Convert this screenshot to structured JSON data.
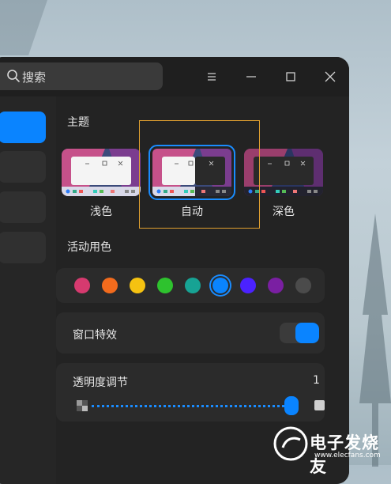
{
  "search": {
    "label": "搜索"
  },
  "titlebar": {
    "menu_icon": "menu-icon",
    "minimize_icon": "minimize-icon",
    "maximize_icon": "maximize-icon",
    "close_icon": "close-icon"
  },
  "theme": {
    "title": "主题",
    "options": [
      {
        "label": "浅色",
        "selected": false
      },
      {
        "label": "自动",
        "selected": true
      },
      {
        "label": "深色",
        "selected": false
      }
    ]
  },
  "accent": {
    "title": "活动用色",
    "colors": [
      "#d63a6f",
      "#f26b1d",
      "#f5c211",
      "#2ec22e",
      "#17a394",
      "#0a84ff",
      "#4b22ff",
      "#7a1fa2",
      "#4b4b4b"
    ],
    "selected_index": 5
  },
  "window_effects": {
    "label": "窗口特效",
    "enabled": true
  },
  "transparency": {
    "label": "透明度调节",
    "value_text": "1",
    "value": 0.93
  },
  "watermark": {
    "text": "电子发烧友",
    "url": "www.elecfans.com"
  }
}
